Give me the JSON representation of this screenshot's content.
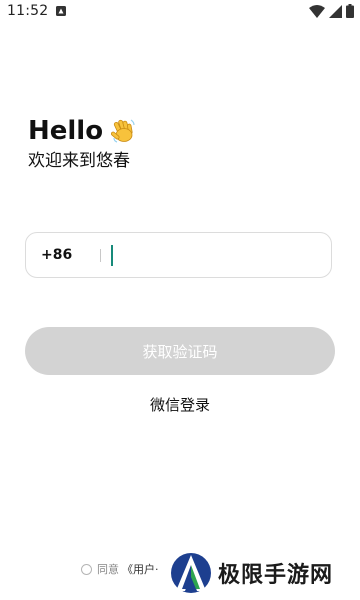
{
  "status_bar": {
    "time": "11:52",
    "icons": [
      "notification-icon",
      "wifi-icon",
      "signal-icon",
      "battery-icon"
    ]
  },
  "greeting": {
    "hello": "Hello",
    "wave_icon": "waving-hand-icon",
    "subtitle": "欢迎来到悠春"
  },
  "phone": {
    "country_code": "+86",
    "value": "",
    "placeholder": ""
  },
  "code_button": {
    "label": "获取验证码",
    "enabled": false
  },
  "wechat_login": {
    "label": "微信登录"
  },
  "agreement": {
    "prefix": "同意",
    "link": "《用户·"
  },
  "watermark": {
    "text": "极限手游网"
  },
  "colors": {
    "accent_caret": "#178a7a",
    "button_disabled": "#d3d3d3",
    "input_border": "#dcdcdc"
  }
}
